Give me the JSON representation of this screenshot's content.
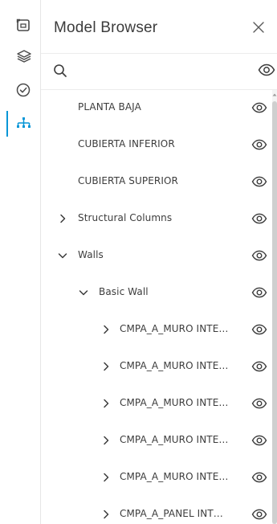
{
  "rail": {
    "items": [
      {
        "icon": "model-view-icon",
        "active": false
      },
      {
        "icon": "layers-icon",
        "active": false
      },
      {
        "icon": "check-circle-icon",
        "active": false
      },
      {
        "icon": "model-browser-tree-icon",
        "active": true
      }
    ]
  },
  "panel": {
    "title": "Model Browser",
    "close_icon": "close-icon"
  },
  "search": {
    "placeholder": "",
    "value": "",
    "icon": "search-icon",
    "visibility_icon": "eye-icon"
  },
  "tree": {
    "rows": [
      {
        "label": "PLANTA BAJA",
        "toggle": "none"
      },
      {
        "label": "CUBIERTA INFERIOR",
        "toggle": "none"
      },
      {
        "label": "CUBIERTA SUPERIOR",
        "toggle": "none"
      },
      {
        "label": "Structural Columns",
        "toggle": "collapsed"
      },
      {
        "label": "Walls",
        "toggle": "expanded"
      },
      {
        "label": "Basic Wall",
        "toggle": "expanded"
      },
      {
        "label": "CMPA_A_MURO INTE…",
        "toggle": "collapsed"
      },
      {
        "label": "CMPA_A_MURO INTE…",
        "toggle": "collapsed"
      },
      {
        "label": "CMPA_A_MURO INTE…",
        "toggle": "collapsed"
      },
      {
        "label": "CMPA_A_MURO INTE…",
        "toggle": "collapsed"
      },
      {
        "label": "CMPA_A_MURO INTE…",
        "toggle": "collapsed"
      },
      {
        "label": "CMPA_A_PANEL INT…",
        "toggle": "collapsed"
      }
    ]
  },
  "colors": {
    "accent": "#0696d7",
    "text": "#3c3c3c",
    "icon": "#4a4a4a"
  }
}
